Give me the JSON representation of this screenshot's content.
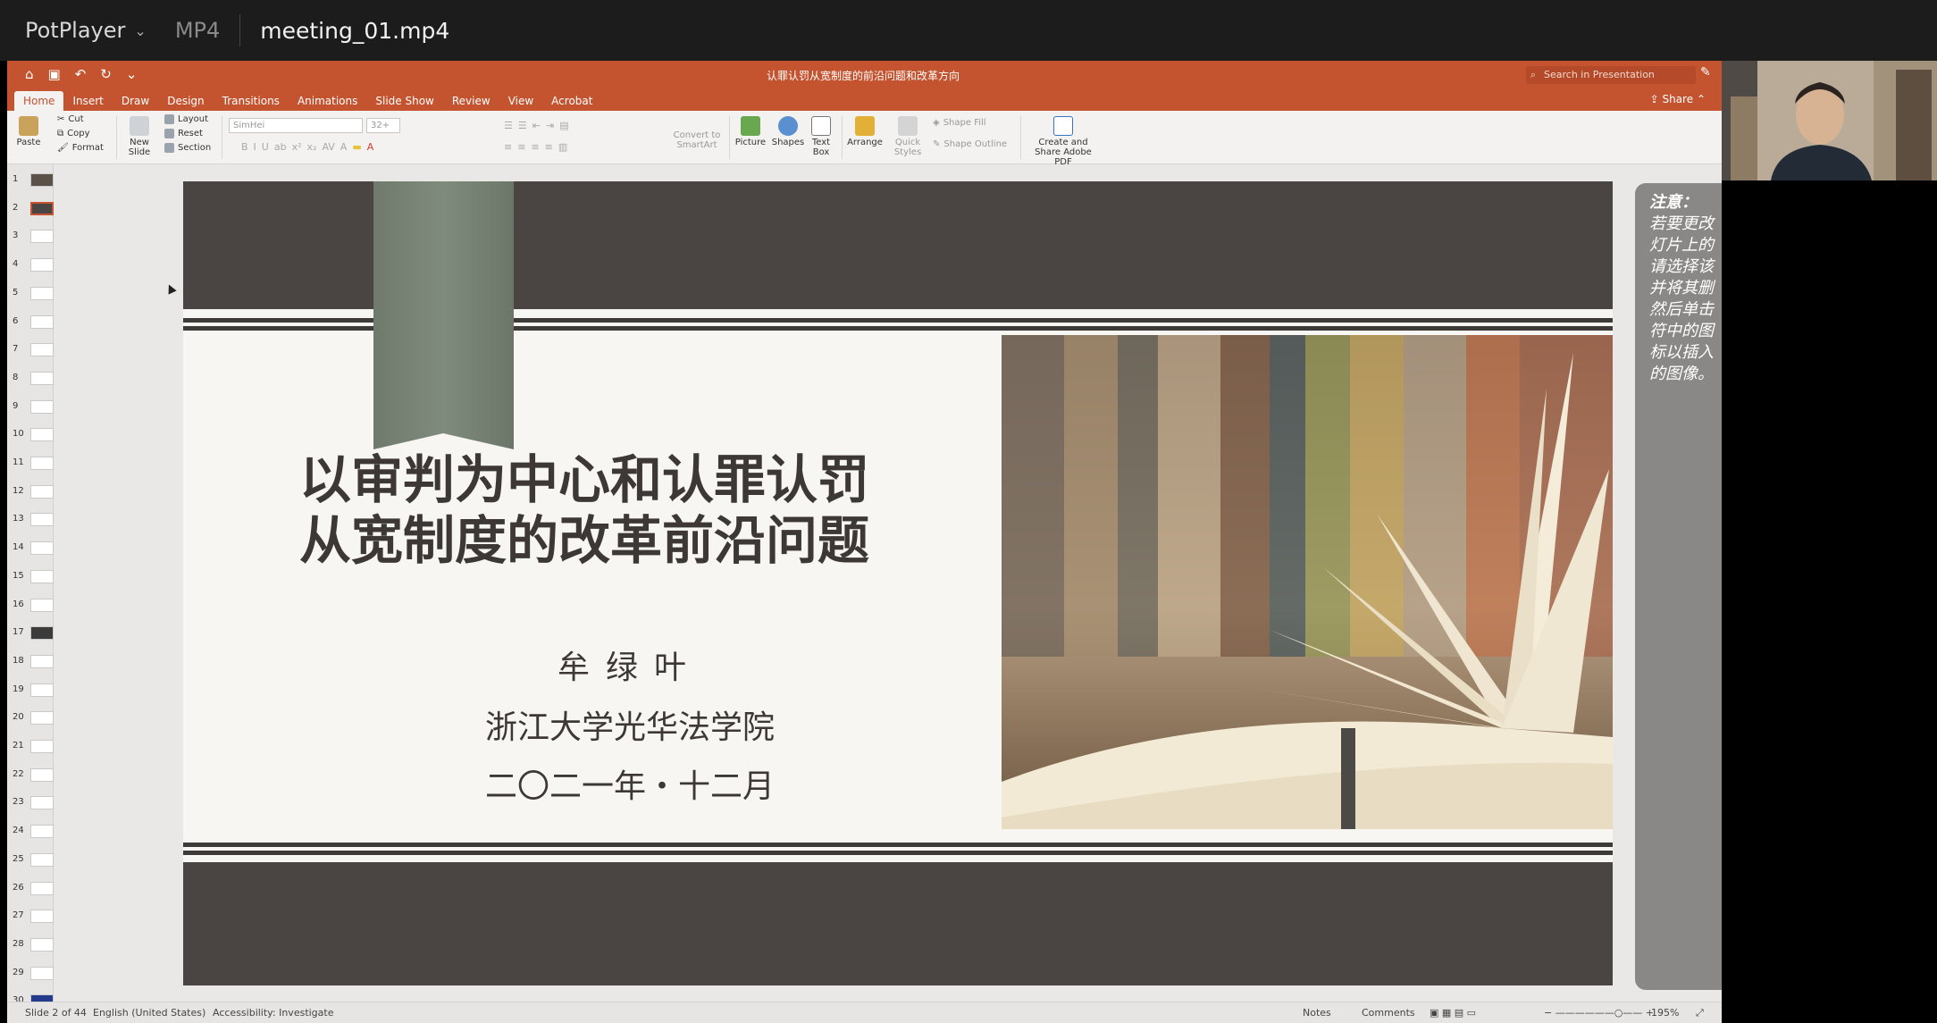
{
  "player": {
    "app_name": "PotPlayer",
    "format": "MP4",
    "file_name": "meeting_01.mp4"
  },
  "powerpoint": {
    "doc_title": "认罪认罚从宽制度的前沿问题和改革方向",
    "search_placeholder": "Search in Presentation",
    "share_label": "Share",
    "tabs": [
      "Home",
      "Insert",
      "Draw",
      "Design",
      "Transitions",
      "Animations",
      "Slide Show",
      "Review",
      "View",
      "Acrobat"
    ],
    "ribbon": {
      "paste": "Paste",
      "cut": "Cut",
      "copy": "Copy",
      "format": "Format",
      "new_slide": "New Slide",
      "layout": "Layout",
      "reset": "Reset",
      "section": "Section",
      "font_name": "SimHei",
      "font_size": "32+",
      "convert_smartart": "Convert to SmartArt",
      "picture": "Picture",
      "shapes": "Shapes",
      "text_box": "Text Box",
      "arrange": "Arrange",
      "quick_styles": "Quick Styles",
      "shape_fill": "Shape Fill",
      "shape_outline": "Shape Outline",
      "create_share_pdf": "Create and Share Adobe PDF"
    },
    "thumbnails": [
      "1",
      "2",
      "3",
      "4",
      "5",
      "6",
      "7",
      "8",
      "9",
      "10",
      "11",
      "12",
      "13",
      "14",
      "15",
      "16",
      "17",
      "18",
      "19",
      "20",
      "21",
      "22",
      "23",
      "24",
      "25",
      "26",
      "27",
      "28",
      "29",
      "30"
    ],
    "selected_thumbnail": "2",
    "slide": {
      "title_line1": "以审判为中心和认罪认罚",
      "title_line2": "从宽制度的改革前沿问题",
      "author": "牟绿叶",
      "institution": "浙江大学光华法学院",
      "date": "二〇二一年・十二月"
    },
    "notes_panel": {
      "heading": "注意：",
      "lines": [
        "若要更改",
        "灯片上的",
        "请选择该",
        "并将其删",
        "然后单击",
        "符中的图",
        "标以插入",
        "的图像。"
      ]
    },
    "status": {
      "slide_info": "Slide 2 of 44",
      "language": "English (United States)",
      "accessibility": "Accessibility: Investigate",
      "notes": "Notes",
      "comments": "Comments",
      "zoom": "195%"
    }
  },
  "colors": {
    "accent": "#c4532f",
    "slide_dark": "#4a4543",
    "slide_bg": "#f7f6f2"
  }
}
